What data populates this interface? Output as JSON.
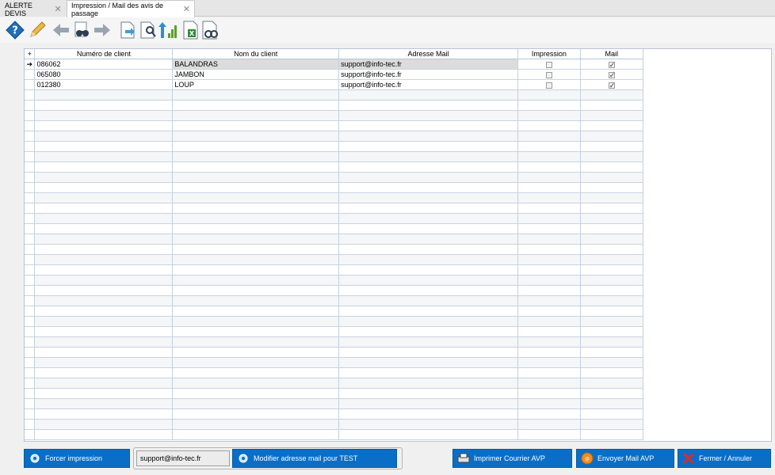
{
  "tabs": [
    {
      "label": "ALERTE DEVIS",
      "active": false
    },
    {
      "label": "Impression / Mail des avis de passage",
      "active": true
    }
  ],
  "toolbar": {
    "icons": [
      "help-icon",
      "edit-pencil-icon",
      "arrow-left-icon",
      "binoculars-icon",
      "arrow-right-icon",
      "export-doc-icon",
      "search-doc-icon",
      "sort-icon",
      "excel-export-icon",
      "link-doc-icon"
    ]
  },
  "grid": {
    "add_symbol": "+",
    "columns": [
      "Numéro de client",
      "Nom du client",
      "Adresse Mail",
      "Impression",
      "Mail"
    ],
    "rows": [
      {
        "numero": "086062",
        "nom": "BALANDRAS",
        "mail": "support@info-tec.fr",
        "impression": false,
        "mail_checked": true,
        "selected": true
      },
      {
        "numero": "065080",
        "nom": "JAMBON",
        "mail": "support@info-tec.fr",
        "impression": false,
        "mail_checked": true,
        "selected": false
      },
      {
        "numero": "012380",
        "nom": "LOUP",
        "mail": "support@info-tec.fr",
        "impression": false,
        "mail_checked": true,
        "selected": false
      }
    ],
    "current_row_indicator": "➔"
  },
  "bottom": {
    "force_print_label": "Forcer impression",
    "test_mail_value": "support@info-tec.fr",
    "modify_mail_label": "Modifier adresse mail pour TEST",
    "print_label": "Imprimer Courrier AVP",
    "send_mail_label": "Envoyer Mail AVP",
    "close_label": "Fermer / Annuler"
  },
  "colors": {
    "button_blue": "#0a6ec6",
    "grid_line": "#c4cfdd",
    "selected_row": "#dcdcdc"
  }
}
